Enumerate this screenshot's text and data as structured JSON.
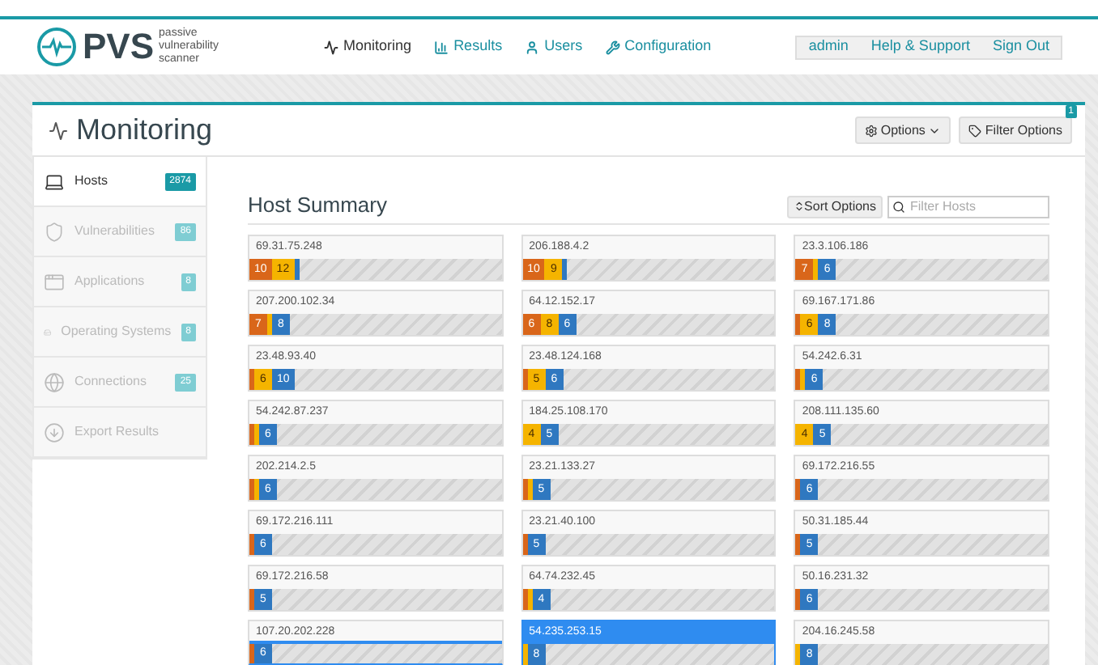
{
  "brand": {
    "name": "PVS",
    "tagline": "passive vulnerability scanner"
  },
  "nav": [
    {
      "label": "Monitoring"
    },
    {
      "label": "Results"
    },
    {
      "label": "Users"
    },
    {
      "label": "Configuration"
    }
  ],
  "user_menu": [
    "admin",
    "Help & Support",
    "Sign Out"
  ],
  "page": {
    "title": "Monitoring",
    "options_button": "Options",
    "filter_button": "Filter Options",
    "filter_count": "1"
  },
  "sidebar": {
    "items": [
      {
        "label": "Hosts",
        "count": "2874",
        "selected": true
      },
      {
        "label": "Vulnerabilities",
        "count": "86",
        "selected": false
      },
      {
        "label": "Applications",
        "count": "8",
        "selected": false
      },
      {
        "label": "Operating Systems",
        "count": "8",
        "selected": false
      },
      {
        "label": "Connections",
        "count": "25",
        "selected": false
      },
      {
        "label": "Export Results",
        "selected": false
      }
    ]
  },
  "host_summary": {
    "title": "Host Summary",
    "sort_button": "Sort Options",
    "filter_placeholder": "Filter Hosts",
    "hosts": [
      {
        "ip": "69.31.75.248",
        "selected": false,
        "hovered": false,
        "segments": [
          {
            "kind": "high",
            "label": "10"
          },
          {
            "kind": "medium",
            "label": "12"
          },
          {
            "kind": "low"
          }
        ]
      },
      {
        "ip": "206.188.4.2",
        "selected": false,
        "hovered": false,
        "segments": [
          {
            "kind": "high",
            "label": "10"
          },
          {
            "kind": "medium",
            "label": "9"
          },
          {
            "kind": "low"
          }
        ]
      },
      {
        "ip": "23.3.106.186",
        "selected": false,
        "hovered": false,
        "segments": [
          {
            "kind": "high",
            "label": "7"
          },
          {
            "kind": "medium"
          },
          {
            "kind": "low",
            "label": "6"
          }
        ]
      },
      {
        "ip": "207.200.102.34",
        "selected": false,
        "hovered": false,
        "segments": [
          {
            "kind": "high",
            "label": "7"
          },
          {
            "kind": "medium"
          },
          {
            "kind": "low",
            "label": "8"
          }
        ]
      },
      {
        "ip": "64.12.152.17",
        "selected": false,
        "hovered": false,
        "segments": [
          {
            "kind": "high",
            "label": "6"
          },
          {
            "kind": "medium",
            "label": "8"
          },
          {
            "kind": "low",
            "label": "6"
          }
        ]
      },
      {
        "ip": "69.167.171.86",
        "selected": false,
        "hovered": false,
        "segments": [
          {
            "kind": "high"
          },
          {
            "kind": "medium",
            "label": "6"
          },
          {
            "kind": "low",
            "label": "8"
          }
        ]
      },
      {
        "ip": "23.48.93.40",
        "selected": false,
        "hovered": false,
        "segments": [
          {
            "kind": "high"
          },
          {
            "kind": "medium",
            "label": "6"
          },
          {
            "kind": "low",
            "label": "10"
          }
        ]
      },
      {
        "ip": "23.48.124.168",
        "selected": false,
        "hovered": false,
        "segments": [
          {
            "kind": "high"
          },
          {
            "kind": "medium",
            "label": "5"
          },
          {
            "kind": "low",
            "label": "6"
          }
        ]
      },
      {
        "ip": "54.242.6.31",
        "selected": false,
        "hovered": false,
        "segments": [
          {
            "kind": "high"
          },
          {
            "kind": "medium"
          },
          {
            "kind": "low",
            "label": "6"
          }
        ]
      },
      {
        "ip": "54.242.87.237",
        "selected": false,
        "hovered": false,
        "segments": [
          {
            "kind": "high"
          },
          {
            "kind": "medium"
          },
          {
            "kind": "low",
            "label": "6"
          }
        ]
      },
      {
        "ip": "184.25.108.170",
        "selected": false,
        "hovered": false,
        "segments": [
          {
            "kind": "medium",
            "label": "4"
          },
          {
            "kind": "low",
            "label": "5"
          }
        ]
      },
      {
        "ip": "208.111.135.60",
        "selected": false,
        "hovered": false,
        "segments": [
          {
            "kind": "medium",
            "label": "4"
          },
          {
            "kind": "low",
            "label": "5"
          }
        ]
      },
      {
        "ip": "202.214.2.5",
        "selected": false,
        "hovered": false,
        "segments": [
          {
            "kind": "high"
          },
          {
            "kind": "medium"
          },
          {
            "kind": "low",
            "label": "6"
          }
        ]
      },
      {
        "ip": "23.21.133.27",
        "selected": false,
        "hovered": false,
        "segments": [
          {
            "kind": "high"
          },
          {
            "kind": "medium"
          },
          {
            "kind": "low",
            "label": "5"
          }
        ]
      },
      {
        "ip": "69.172.216.55",
        "selected": false,
        "hovered": false,
        "segments": [
          {
            "kind": "high"
          },
          {
            "kind": "low",
            "label": "6"
          }
        ]
      },
      {
        "ip": "69.172.216.111",
        "selected": false,
        "hovered": false,
        "segments": [
          {
            "kind": "high"
          },
          {
            "kind": "low",
            "label": "6"
          }
        ]
      },
      {
        "ip": "23.21.40.100",
        "selected": false,
        "hovered": false,
        "segments": [
          {
            "kind": "high"
          },
          {
            "kind": "low",
            "label": "5"
          }
        ]
      },
      {
        "ip": "50.31.185.44",
        "selected": false,
        "hovered": false,
        "segments": [
          {
            "kind": "high"
          },
          {
            "kind": "low",
            "label": "5"
          }
        ]
      },
      {
        "ip": "69.172.216.58",
        "selected": false,
        "hovered": false,
        "segments": [
          {
            "kind": "high"
          },
          {
            "kind": "low",
            "label": "5"
          }
        ]
      },
      {
        "ip": "64.74.232.45",
        "selected": false,
        "hovered": false,
        "segments": [
          {
            "kind": "high"
          },
          {
            "kind": "medium"
          },
          {
            "kind": "low",
            "label": "4"
          }
        ]
      },
      {
        "ip": "50.16.231.32",
        "selected": false,
        "hovered": false,
        "segments": [
          {
            "kind": "high"
          },
          {
            "kind": "low",
            "label": "6"
          }
        ]
      },
      {
        "ip": "107.20.202.228",
        "selected": false,
        "hovered": true,
        "segments": [
          {
            "kind": "high"
          },
          {
            "kind": "low",
            "label": "6"
          }
        ]
      },
      {
        "ip": "54.235.253.15",
        "selected": true,
        "hovered": false,
        "segments": [
          {
            "kind": "medium"
          },
          {
            "kind": "low",
            "label": "8"
          }
        ]
      },
      {
        "ip": "204.16.245.58",
        "selected": false,
        "hovered": false,
        "segments": [
          {
            "kind": "medium"
          },
          {
            "kind": "low",
            "label": "8"
          }
        ]
      }
    ]
  }
}
